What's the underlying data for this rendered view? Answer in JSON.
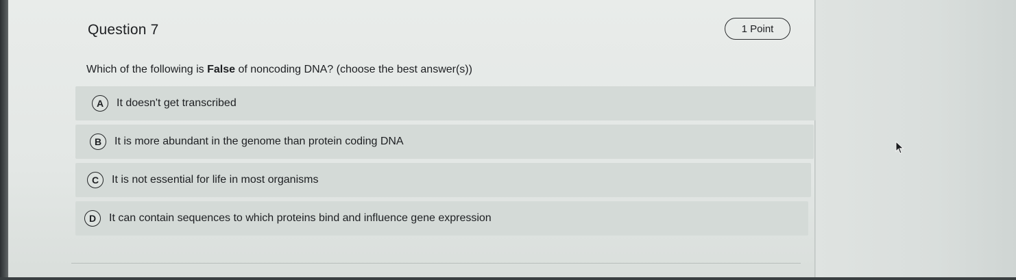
{
  "question": {
    "title": "Question 7",
    "points": "1 Point",
    "text_before": "Which of the following is ",
    "text_bold": "False",
    "text_after": " of noncoding DNA? (choose the best answer(s))"
  },
  "options": [
    {
      "letter": "A",
      "text": "It doesn't get transcribed"
    },
    {
      "letter": "B",
      "text": "It is more abundant in the genome than protein coding DNA"
    },
    {
      "letter": "C",
      "text": "It is not essential for life in most organisms"
    },
    {
      "letter": "D",
      "text": "It can contain sequences to which proteins bind and influence gene expression"
    }
  ],
  "icons": {
    "cursor": "mouse-pointer-icon"
  }
}
